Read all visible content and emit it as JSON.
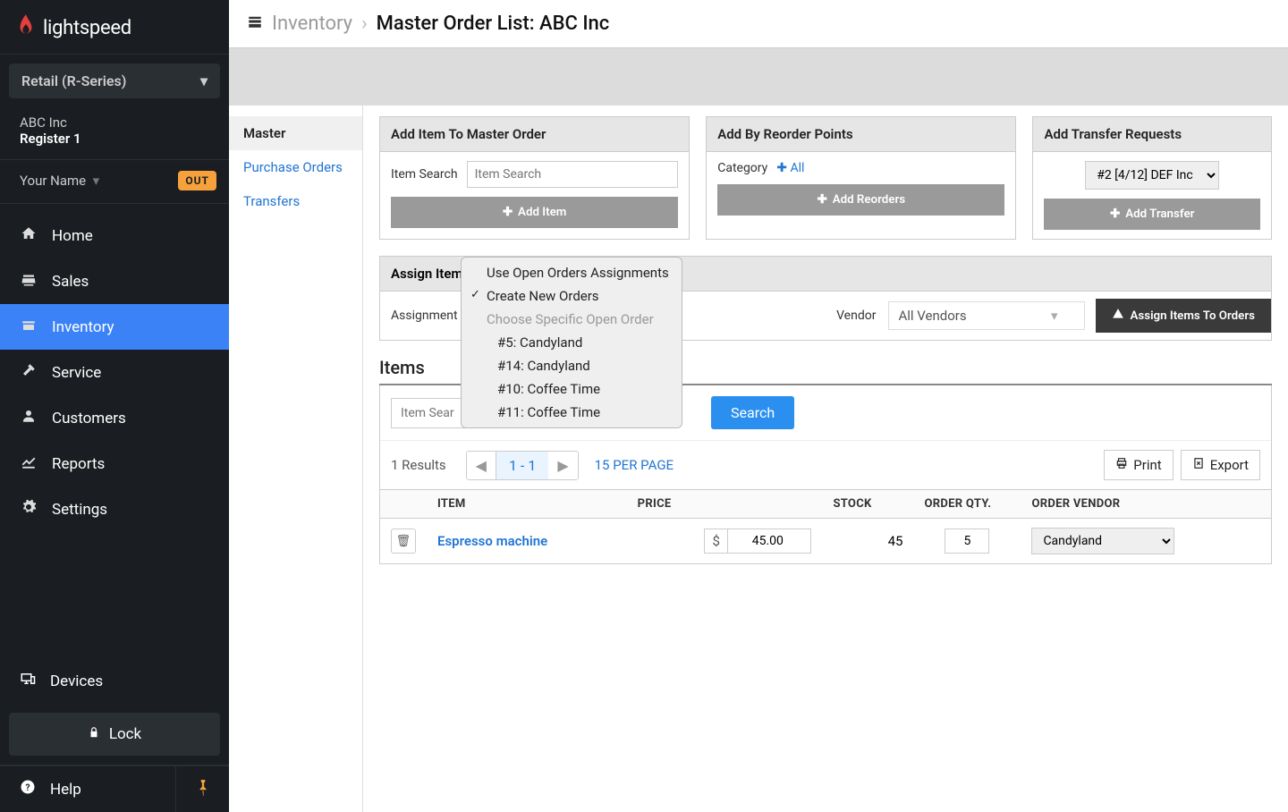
{
  "logo_text": "lightspeed",
  "series": "Retail (R-Series)",
  "company": "ABC Inc",
  "register": "Register 1",
  "user": "Your Name",
  "out_badge": "OUT",
  "nav": [
    {
      "label": "Home",
      "icon": "home"
    },
    {
      "label": "Sales",
      "icon": "sales"
    },
    {
      "label": "Inventory",
      "icon": "inventory",
      "active": true
    },
    {
      "label": "Service",
      "icon": "service"
    },
    {
      "label": "Customers",
      "icon": "customers"
    },
    {
      "label": "Reports",
      "icon": "reports"
    },
    {
      "label": "Settings",
      "icon": "settings"
    }
  ],
  "devices_label": "Devices",
  "lock_label": "Lock",
  "help_label": "Help",
  "breadcrumb": {
    "section": "Inventory",
    "title": "Master Order List:  ABC Inc"
  },
  "subnav": {
    "master": "Master",
    "po": "Purchase Orders",
    "transfers": "Transfers"
  },
  "addItem": {
    "head": "Add Item To Master Order",
    "search_label": "Item Search",
    "search_placeholder": "Item Search",
    "button": "Add Item"
  },
  "addReorder": {
    "head": "Add By Reorder Points",
    "category_label": "Category",
    "category_link": "All",
    "button": "Add Reorders"
  },
  "addTransfer": {
    "head": "Add Transfer Requests",
    "select_value": "#2 [4/12] DEF Inc",
    "button": "Add Transfer"
  },
  "assign": {
    "head": "Assign Items To Purchase Orders",
    "label": "Assignment",
    "vendor_label": "Vendor",
    "vendor_value": "All Vendors",
    "button": "Assign Items To Orders",
    "dropdown": {
      "opt1": "Use Open Orders Assignments",
      "opt2": "Create New Orders",
      "opt3": "Choose Specific Open Order",
      "opt4": "#5: Candyland",
      "opt5": "#14: Candyland",
      "opt6": "#10: Coffee Time",
      "opt7": "#11: Coffee Time"
    }
  },
  "items": {
    "title": "Items",
    "search_placeholder": "Item Sear",
    "search_button": "Search",
    "results": "1 Results",
    "range": "1 - 1",
    "per_page": "15 PER PAGE",
    "print": "Print",
    "export": "Export",
    "columns": {
      "item": "ITEM",
      "price": "PRICE",
      "stock": "STOCK",
      "qty": "ORDER QTY.",
      "vendor": "ORDER VENDOR"
    },
    "rows": [
      {
        "name": "Espresso machine",
        "price": "45.00",
        "stock": "45",
        "qty": "5",
        "vendor": "Candyland"
      }
    ]
  },
  "currency": "$"
}
